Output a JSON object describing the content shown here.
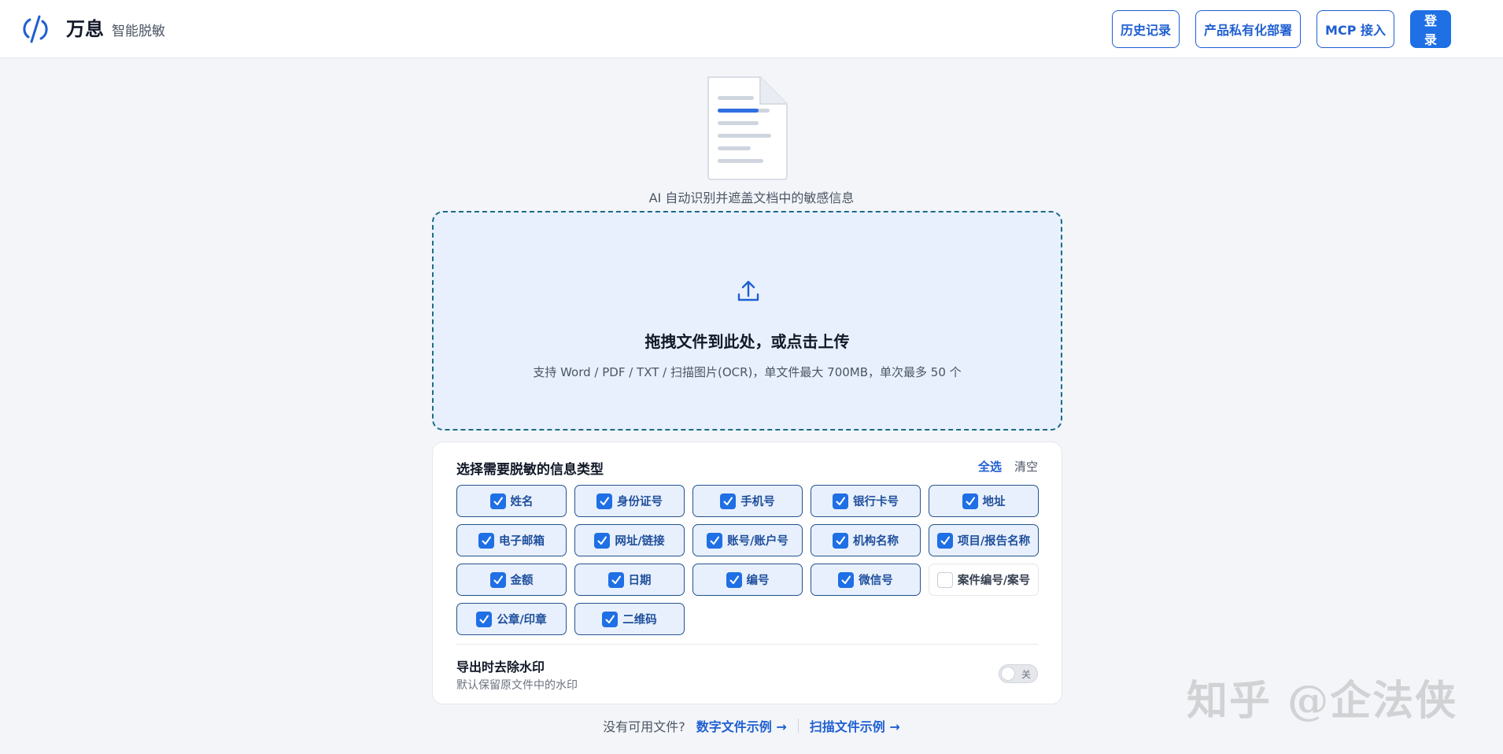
{
  "header": {
    "brand_name": "万息",
    "brand_sub": "智能脱敏",
    "buttons": {
      "history": "历史记录",
      "private_deploy": "产品私有化部署",
      "mcp": "MCP 接入",
      "login": "登录"
    }
  },
  "tagline": "AI 自动识别并遮盖文档中的敏感信息",
  "upload": {
    "title": "拖拽文件到此处，或点击上传",
    "hint": "支持 Word / PDF / TXT / 扫描图片(OCR)，单文件最大 700MB，单次最多 50 个"
  },
  "options": {
    "title": "选择需要脱敏的信息类型",
    "select_all": "全选",
    "clear": "清空",
    "items": [
      {
        "label": "姓名",
        "checked": true
      },
      {
        "label": "身份证号",
        "checked": true
      },
      {
        "label": "手机号",
        "checked": true
      },
      {
        "label": "银行卡号",
        "checked": true
      },
      {
        "label": "地址",
        "checked": true
      },
      {
        "label": "电子邮箱",
        "checked": true
      },
      {
        "label": "网址/链接",
        "checked": true
      },
      {
        "label": "账号/账户号",
        "checked": true
      },
      {
        "label": "机构名称",
        "checked": true
      },
      {
        "label": "项目/报告名称",
        "checked": true
      },
      {
        "label": "金额",
        "checked": true
      },
      {
        "label": "日期",
        "checked": true
      },
      {
        "label": "编号",
        "checked": true
      },
      {
        "label": "微信号",
        "checked": true
      },
      {
        "label": "案件编号/案号",
        "checked": false
      },
      {
        "label": "公章/印章",
        "checked": true
      },
      {
        "label": "二维码",
        "checked": true
      }
    ],
    "watermark": {
      "title": "导出时去除水印",
      "subtitle": "默认保留原文件中的水印",
      "toggle_label": "关",
      "enabled": false
    }
  },
  "footer": {
    "no_file": "没有可用文件?",
    "digital_example": "数字文件示例 →",
    "scan_example": "扫描文件示例 →"
  },
  "overlay_watermark": "知乎 @企法侠",
  "colors": {
    "accent": "#1f6fe5",
    "upload_bg": "#e8f0fd",
    "page_bg": "#f3f5f9"
  }
}
